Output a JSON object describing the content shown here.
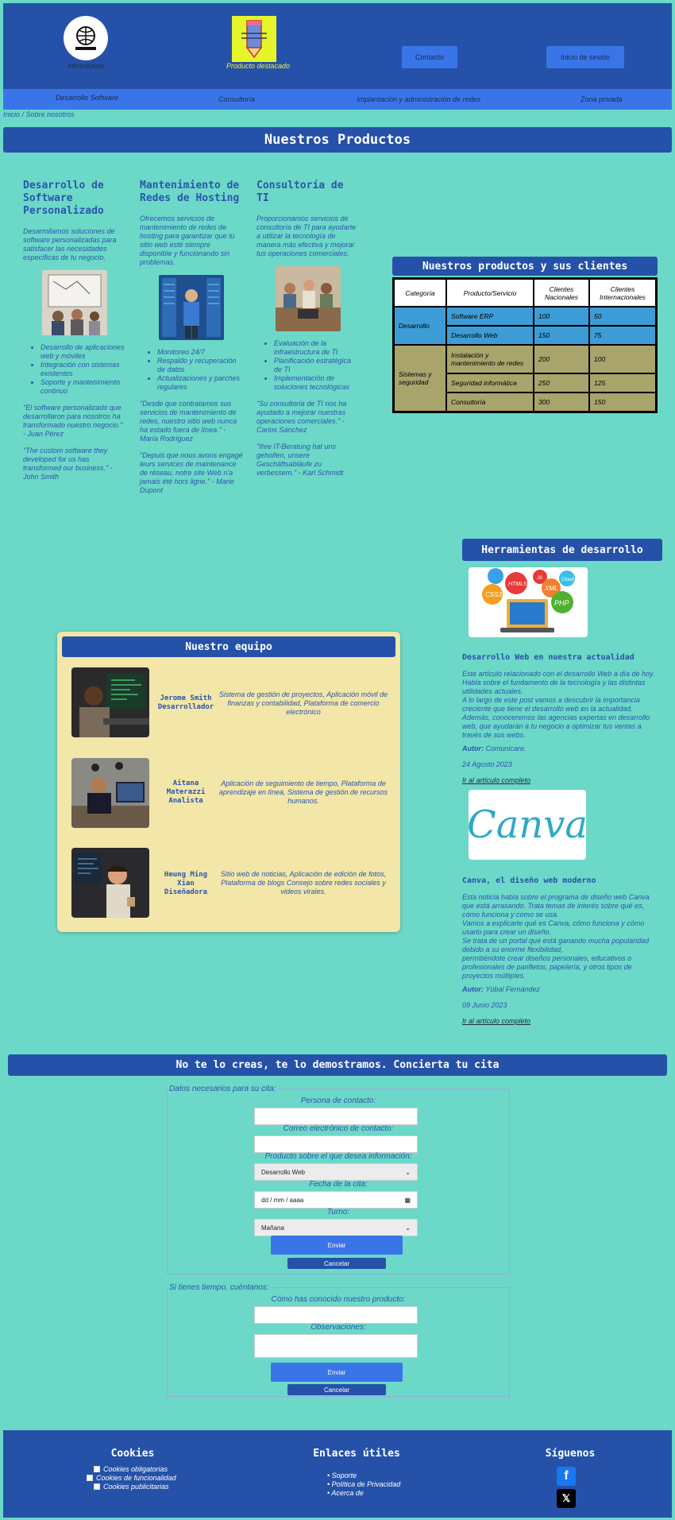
{
  "header": {
    "logo_text": "infosolution",
    "featured_label": "Producto destacado",
    "contact_button": "Contacto",
    "login_button": "Inicio de sesión"
  },
  "nav": {
    "items": [
      "Desarrollo Software",
      "Consultoría",
      "Implantación y administración de redes",
      "Zona privada"
    ]
  },
  "breadcrumb": "Inicio  / Sobre nosotros",
  "products": {
    "title": "Nuestros Productos",
    "columns": [
      {
        "title": "Desarrollo de Software Personalizado",
        "description": "Desarrollamos soluciones de software personalizadas para satisfacer las necesidades específicas de tu negocio.",
        "bullets": [
          "Desarrollo de aplicaciones web y móviles",
          "Integración con sistemas existentes",
          "Soporte y mantenimiento continuo"
        ],
        "quotes": [
          "\"El software personalizado que desarrollaron para nosotros ha transformado nuestro negocio.\" - Juan Pérez",
          "\"The custom software they developed for us has transformed our business.\" - John Smith"
        ]
      },
      {
        "title": "Mantenimiento de Redes de Hosting",
        "description": "Ofrecemos servicios de mantenimiento de redes de hosting para garantizar que tu sitio web esté siempre disponible y funcionando sin problemas.",
        "bullets": [
          "Monitoreo 24/7",
          "Respaldo y recuperación de datos",
          "Actualizaciones y parches regulares"
        ],
        "quotes": [
          "\"Desde que contratamos sus servicios de mantenimiento de redes, nuestro sitio web nunca ha estado fuera de línea.\" - María Rodríguez",
          "\"Depuis que nous avons engagé leurs services de maintenance de réseau, notre site Web n'a jamais été hors ligne.\" - Marie Dupont"
        ]
      },
      {
        "title": "Consultoría de TI",
        "description": "Proporcionamos servicios de consultoría de TI para ayudarte a utilizar la tecnología de manera más efectiva y mejorar tus operaciones comerciales.",
        "bullets": [
          "Evaluación de la infraestructura de TI",
          "Planificación estratégica de TI",
          "Implementación de soluciones tecnológicas"
        ],
        "quotes": [
          "\"Su consultoría de TI nos ha ayudado a mejorar nuestras operaciones comerciales.\" - Carlos Sánchez",
          "\"Ihre IT-Beratung hat uns geholfen, unsere Geschäftsabläufe zu verbessern.\" - Karl Schmidt"
        ]
      }
    ]
  },
  "clients_table": {
    "title": "Nuestros productos y sus clientes",
    "headers": [
      "Categoría",
      "Producto/Servicio",
      "Clientes Nacionales",
      "Clientes Internacionales"
    ],
    "groups": [
      {
        "category": "Desarrollo",
        "rows": [
          [
            "Software ERP",
            "100",
            "50"
          ],
          [
            "Desarrollo Web",
            "150",
            "75"
          ]
        ]
      },
      {
        "category": "Sistemas y seguridad",
        "rows": [
          [
            "Instalación y mantenimiento de redes",
            "200",
            "100"
          ],
          [
            "Seguridad informática",
            "250",
            "125"
          ],
          [
            "Consultoría",
            "300",
            "150"
          ]
        ]
      }
    ]
  },
  "tools": {
    "title": "Herramientas de desarrollo",
    "collage_labels": [
      "HTML5",
      "CSS3",
      "XML",
      "PHP",
      "Cloud",
      "JS"
    ],
    "articles": [
      {
        "title": "Desarrollo Web en nuestra actualidad",
        "paragraphs": [
          "Este artículo relacionado con el desarrollo Web a día de hoy. Habla sobre el fundamento de la tecnología y las distintas utilidades actuales.",
          "A lo largo de este post vamos a descubrir la importancia creciente que tiene el desarrollo web en la actualidad.",
          "Además, conoceremos las agencias expertas en desarrollo web, que ayudarán a tu negocio a optimizar tus ventas a través de sus webs."
        ],
        "author_label": "Autor:",
        "author": "Comunicare.",
        "date": "24 Agosto 2023",
        "link": "Ir al artículo completo"
      },
      {
        "image_text": "Canva",
        "title": "Canva, el diseño web moderno",
        "paragraphs": [
          "Esta noticia habla sobre el programa de diseño web Canva que está arrasando. Trata temas de interés sobre qué es, cómo funciona y como se usa.",
          "Vamos a explicarte qué es Canva, cómo funciona y cómo usarlo para crear un diseño.",
          "Se trata de un portal que está ganando mucha popularidad debido a su enorme flexibilidad,",
          "permitiéndote crear diseños personales, educativos o profesionales de panfletos, papelería, y otros tipos de proyectos múltiples."
        ],
        "author_label": "Autor:",
        "author": "Yúbal Fernández",
        "date": "09 Junio 2023",
        "link": "Ir al artículo completo"
      }
    ]
  },
  "team": {
    "title": "Nuestro equipo",
    "members": [
      {
        "name": "Jerome Smith",
        "role": "Desarrollador",
        "projects": "Sistema de gestión de proyectos, Aplicación móvil de finanzas y contabilidad, Plataforma de comercio electrónico"
      },
      {
        "name": "Aitana Materazzi",
        "role": "Analista",
        "projects": "Aplicación de seguimiento de tiempo, Plataforma de aprendizaje en línea, Sistema de gestión de recursos humanos."
      },
      {
        "name": "Heung Ming Xian",
        "role": "Diseñadora",
        "projects": "Sitio web de noticias, Aplicación de edición de fotos, Plataforma de blogs Consejo sobre redes sociales y videos virales."
      }
    ]
  },
  "appointment": {
    "title": "No te lo creas, te lo demostramos. Concierta tu cita",
    "form1": {
      "legend": "Datos necesarios para su cita:",
      "contact_label": "Persona de contacto:",
      "email_label": "Correo electrónico de contacto:",
      "product_label": "Producto sobre el que desea información:",
      "product_value": "Desarrollo Web",
      "date_label": "Fecha de la cita:",
      "date_placeholder": "dd / mm / aaaa",
      "shift_label": "Turno:",
      "shift_value": "Mañana",
      "send": "Enviar",
      "cancel": "Cancelar"
    },
    "form2": {
      "legend": "Si tienes tiempo, cuéntanos:",
      "source_label": "Cómo has conocido nuestro producto:",
      "notes_label": "Observaciones:",
      "send": "Enviar",
      "cancel": "Cancelar"
    }
  },
  "footer": {
    "cookies_title": "Cookies",
    "cookies": [
      "Cookies obligatorias",
      "Cookies de funcionalidad",
      "Cookies publicitarias"
    ],
    "links_title": "Enlaces útiles",
    "links": [
      "Soporte",
      "Política de Privacidad",
      "Acerca de"
    ],
    "social_title": "Síguenos"
  },
  "colors": {
    "background": "#6cd8c8",
    "brand": "#2552a8",
    "accent": "#3a75e8",
    "team_card": "#f2e6a8"
  }
}
